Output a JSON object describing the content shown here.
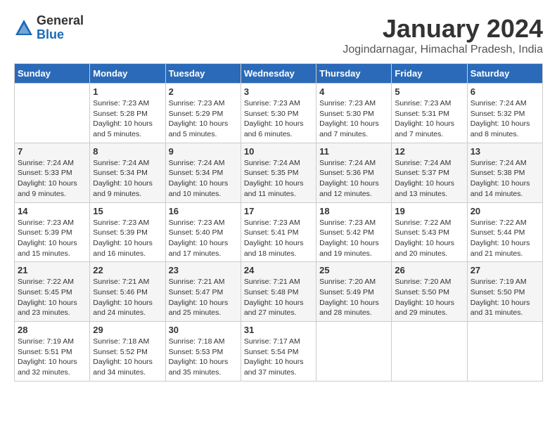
{
  "header": {
    "logo_general": "General",
    "logo_blue": "Blue",
    "month_title": "January 2024",
    "subtitle": "Jogindarnagar, Himachal Pradesh, India"
  },
  "weekdays": [
    "Sunday",
    "Monday",
    "Tuesday",
    "Wednesday",
    "Thursday",
    "Friday",
    "Saturday"
  ],
  "weeks": [
    [
      {
        "day": "",
        "info": ""
      },
      {
        "day": "1",
        "info": "Sunrise: 7:23 AM\nSunset: 5:28 PM\nDaylight: 10 hours\nand 5 minutes."
      },
      {
        "day": "2",
        "info": "Sunrise: 7:23 AM\nSunset: 5:29 PM\nDaylight: 10 hours\nand 5 minutes."
      },
      {
        "day": "3",
        "info": "Sunrise: 7:23 AM\nSunset: 5:30 PM\nDaylight: 10 hours\nand 6 minutes."
      },
      {
        "day": "4",
        "info": "Sunrise: 7:23 AM\nSunset: 5:30 PM\nDaylight: 10 hours\nand 7 minutes."
      },
      {
        "day": "5",
        "info": "Sunrise: 7:23 AM\nSunset: 5:31 PM\nDaylight: 10 hours\nand 7 minutes."
      },
      {
        "day": "6",
        "info": "Sunrise: 7:24 AM\nSunset: 5:32 PM\nDaylight: 10 hours\nand 8 minutes."
      }
    ],
    [
      {
        "day": "7",
        "info": "Sunrise: 7:24 AM\nSunset: 5:33 PM\nDaylight: 10 hours\nand 9 minutes."
      },
      {
        "day": "8",
        "info": "Sunrise: 7:24 AM\nSunset: 5:34 PM\nDaylight: 10 hours\nand 9 minutes."
      },
      {
        "day": "9",
        "info": "Sunrise: 7:24 AM\nSunset: 5:34 PM\nDaylight: 10 hours\nand 10 minutes."
      },
      {
        "day": "10",
        "info": "Sunrise: 7:24 AM\nSunset: 5:35 PM\nDaylight: 10 hours\nand 11 minutes."
      },
      {
        "day": "11",
        "info": "Sunrise: 7:24 AM\nSunset: 5:36 PM\nDaylight: 10 hours\nand 12 minutes."
      },
      {
        "day": "12",
        "info": "Sunrise: 7:24 AM\nSunset: 5:37 PM\nDaylight: 10 hours\nand 13 minutes."
      },
      {
        "day": "13",
        "info": "Sunrise: 7:24 AM\nSunset: 5:38 PM\nDaylight: 10 hours\nand 14 minutes."
      }
    ],
    [
      {
        "day": "14",
        "info": "Sunrise: 7:23 AM\nSunset: 5:39 PM\nDaylight: 10 hours\nand 15 minutes."
      },
      {
        "day": "15",
        "info": "Sunrise: 7:23 AM\nSunset: 5:39 PM\nDaylight: 10 hours\nand 16 minutes."
      },
      {
        "day": "16",
        "info": "Sunrise: 7:23 AM\nSunset: 5:40 PM\nDaylight: 10 hours\nand 17 minutes."
      },
      {
        "day": "17",
        "info": "Sunrise: 7:23 AM\nSunset: 5:41 PM\nDaylight: 10 hours\nand 18 minutes."
      },
      {
        "day": "18",
        "info": "Sunrise: 7:23 AM\nSunset: 5:42 PM\nDaylight: 10 hours\nand 19 minutes."
      },
      {
        "day": "19",
        "info": "Sunrise: 7:22 AM\nSunset: 5:43 PM\nDaylight: 10 hours\nand 20 minutes."
      },
      {
        "day": "20",
        "info": "Sunrise: 7:22 AM\nSunset: 5:44 PM\nDaylight: 10 hours\nand 21 minutes."
      }
    ],
    [
      {
        "day": "21",
        "info": "Sunrise: 7:22 AM\nSunset: 5:45 PM\nDaylight: 10 hours\nand 23 minutes."
      },
      {
        "day": "22",
        "info": "Sunrise: 7:21 AM\nSunset: 5:46 PM\nDaylight: 10 hours\nand 24 minutes."
      },
      {
        "day": "23",
        "info": "Sunrise: 7:21 AM\nSunset: 5:47 PM\nDaylight: 10 hours\nand 25 minutes."
      },
      {
        "day": "24",
        "info": "Sunrise: 7:21 AM\nSunset: 5:48 PM\nDaylight: 10 hours\nand 27 minutes."
      },
      {
        "day": "25",
        "info": "Sunrise: 7:20 AM\nSunset: 5:49 PM\nDaylight: 10 hours\nand 28 minutes."
      },
      {
        "day": "26",
        "info": "Sunrise: 7:20 AM\nSunset: 5:50 PM\nDaylight: 10 hours\nand 29 minutes."
      },
      {
        "day": "27",
        "info": "Sunrise: 7:19 AM\nSunset: 5:50 PM\nDaylight: 10 hours\nand 31 minutes."
      }
    ],
    [
      {
        "day": "28",
        "info": "Sunrise: 7:19 AM\nSunset: 5:51 PM\nDaylight: 10 hours\nand 32 minutes."
      },
      {
        "day": "29",
        "info": "Sunrise: 7:18 AM\nSunset: 5:52 PM\nDaylight: 10 hours\nand 34 minutes."
      },
      {
        "day": "30",
        "info": "Sunrise: 7:18 AM\nSunset: 5:53 PM\nDaylight: 10 hours\nand 35 minutes."
      },
      {
        "day": "31",
        "info": "Sunrise: 7:17 AM\nSunset: 5:54 PM\nDaylight: 10 hours\nand 37 minutes."
      },
      {
        "day": "",
        "info": ""
      },
      {
        "day": "",
        "info": ""
      },
      {
        "day": "",
        "info": ""
      }
    ]
  ]
}
